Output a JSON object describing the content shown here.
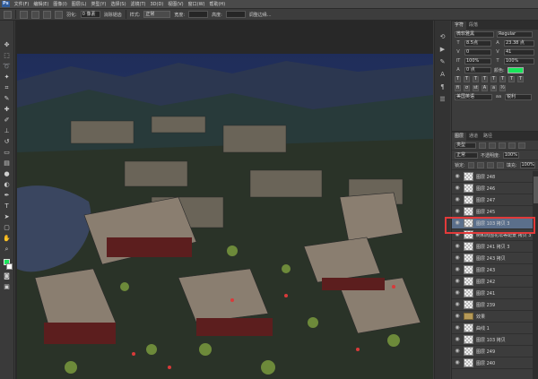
{
  "app": {
    "logo": "Ps"
  },
  "menu": [
    "文件(F)",
    "编辑(E)",
    "图像(I)",
    "图层(L)",
    "类型(Y)",
    "选择(S)",
    "滤镜(T)",
    "3D(D)",
    "视图(V)",
    "窗口(W)",
    "帮助(H)"
  ],
  "options": {
    "feather_label": "羽化:",
    "feather_value": "0 像素",
    "antialias_label": "消除锯齿",
    "style_label": "样式:",
    "style_value": "正常",
    "width_label": "宽度:",
    "height_label": "高度:",
    "refine_label": "调整边缘..."
  },
  "char_panel": {
    "tabs": [
      "字符",
      "段落"
    ],
    "font_family": "微软雅黑",
    "font_style": "Regular",
    "font_size": "8.5点",
    "leading": "23.38 点",
    "kerning": "0",
    "tracking": "41",
    "vscale": "100%",
    "hscale": "100%",
    "baseline": "0 点",
    "color_label": "颜色:",
    "lang": "美国英语",
    "aa": "锐利"
  },
  "layers_panel": {
    "tabs": [
      "图层",
      "通道",
      "路径"
    ],
    "kind_label": "类型",
    "blend_mode": "正常",
    "opacity_label": "不透明度:",
    "opacity_value": "100%",
    "lock_label": "锁定:",
    "fill_label": "填充:",
    "fill_value": "100%",
    "layers": [
      {
        "name": "图层 248",
        "type": "layer"
      },
      {
        "name": "图层 246",
        "type": "layer"
      },
      {
        "name": "图层 247",
        "type": "layer"
      },
      {
        "name": "图层 245",
        "type": "layer"
      },
      {
        "name": "图层 103 拷贝 3",
        "type": "layer",
        "selected": true
      },
      {
        "name": "树和周围花坛等配景 拷贝 3",
        "type": "layer"
      },
      {
        "name": "图层 241 拷贝 3",
        "type": "layer"
      },
      {
        "name": "图层 243 拷贝",
        "type": "layer"
      },
      {
        "name": "图层 243",
        "type": "layer"
      },
      {
        "name": "图层 242",
        "type": "layer"
      },
      {
        "name": "图层 241",
        "type": "layer"
      },
      {
        "name": "图层 239",
        "type": "layer"
      },
      {
        "name": "效果",
        "type": "folder"
      },
      {
        "name": "曲线 1",
        "type": "layer"
      },
      {
        "name": "图层 103 拷贝",
        "type": "layer"
      },
      {
        "name": "图层 249",
        "type": "layer"
      },
      {
        "name": "图层 240",
        "type": "layer"
      }
    ]
  },
  "colors": {
    "foreground": "#19e65a",
    "highlight": "#e23a3a",
    "selected_row": "#5b6f8b"
  }
}
